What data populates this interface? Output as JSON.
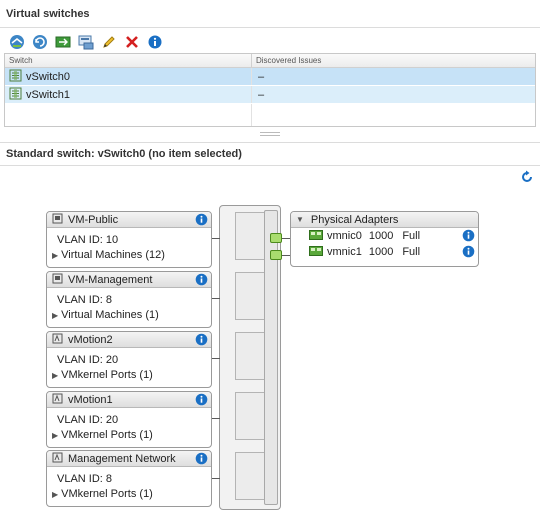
{
  "top_section": {
    "title": "Virtual switches"
  },
  "toolbar": {
    "buttons": [
      {
        "icon": "add-networking-icon"
      },
      {
        "icon": "refresh-switch-icon"
      },
      {
        "icon": "migrate-networking-icon"
      },
      {
        "icon": "switch-settings-icon"
      },
      {
        "icon": "edit-pencil-icon"
      },
      {
        "icon": "remove-x-icon"
      },
      {
        "icon": "info-icon"
      }
    ]
  },
  "grid": {
    "headers": [
      "Switch",
      "Discovered Issues"
    ],
    "rows": [
      {
        "switch": "vSwitch0",
        "issues": "–"
      },
      {
        "switch": "vSwitch1",
        "issues": "–"
      }
    ]
  },
  "detail": {
    "title": "Standard switch: vSwitch0 (no item selected)"
  },
  "port_groups": [
    {
      "name": "VM-Public",
      "vlan": "VLAN ID: 10",
      "members": "Virtual Machines (12)"
    },
    {
      "name": "VM-Management",
      "vlan": "VLAN ID: 8",
      "members": "Virtual Machines (1)"
    },
    {
      "name": "vMotion2",
      "vlan": "VLAN ID: 20",
      "members": "VMkernel Ports (1)"
    },
    {
      "name": "vMotion1",
      "vlan": "VLAN ID: 20",
      "members": "VMkernel Ports (1)"
    },
    {
      "name": "Management Network",
      "vlan": "VLAN ID: 8",
      "members": "VMkernel Ports (1)"
    }
  ],
  "physical_adapters": {
    "title": "Physical Adapters",
    "adapters": [
      {
        "name": "vmnic0",
        "speed": "1000",
        "duplex": "Full"
      },
      {
        "name": "vmnic1",
        "speed": "1000",
        "duplex": "Full"
      }
    ]
  },
  "colors": {
    "accent": "#1a6fc4",
    "selected_row": "#c6e2f7",
    "port_green": "#a9dc6e"
  }
}
